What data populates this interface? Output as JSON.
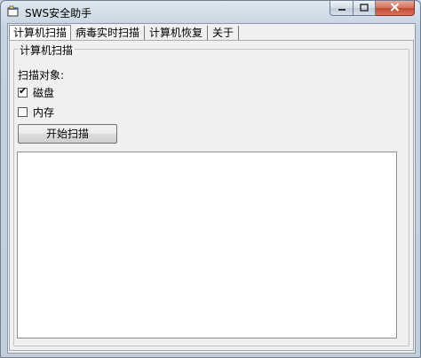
{
  "window": {
    "title": "SWS安全助手",
    "icon": "app-window-icon",
    "buttons": {
      "minimize_icon": "minimize-icon",
      "maximize_icon": "maximize-icon",
      "close_icon": "close-icon"
    }
  },
  "tabs": [
    {
      "label": "计算机扫描",
      "active": true
    },
    {
      "label": "病毒实时扫描",
      "active": false
    },
    {
      "label": "计算机恢复",
      "active": false
    },
    {
      "label": "关于",
      "active": false
    }
  ],
  "panel": {
    "group_title": "计算机扫描",
    "scan_target_label": "扫描对象:",
    "options": [
      {
        "label": "磁盘",
        "checked": true
      },
      {
        "label": "内存",
        "checked": false
      }
    ],
    "start_button": "开始扫描",
    "result_text": ""
  },
  "colors": {
    "titlebar": "#dfe8f1",
    "close_button": "#c14a33",
    "client_bg": "#f0f0f0"
  }
}
